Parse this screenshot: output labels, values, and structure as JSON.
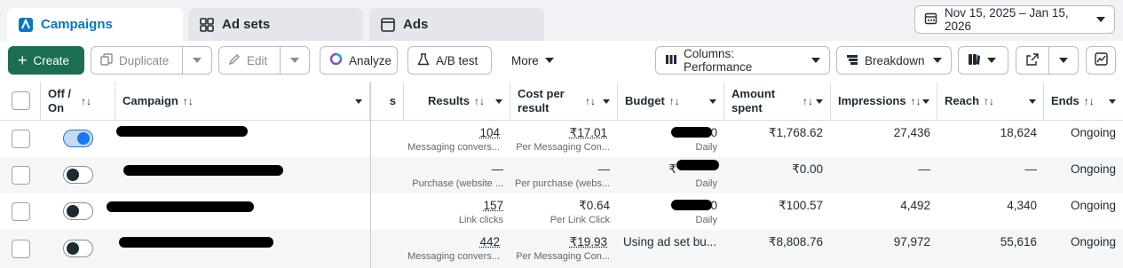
{
  "tabs": [
    {
      "label": "Campaigns",
      "icon": "campaign-icon"
    },
    {
      "label": "Ad sets",
      "icon": "adsets-grid-icon"
    },
    {
      "label": "Ads",
      "icon": "ad-window-icon"
    }
  ],
  "date_range": "Nov 15, 2025 – Jan 15, 2026",
  "toolbar": {
    "create": "Create",
    "duplicate": "Duplicate",
    "edit": "Edit",
    "analyze": "Analyze",
    "ab_test": "A/B test",
    "more": "More",
    "columns": "Columns: Performance",
    "breakdown": "Breakdown"
  },
  "headers": {
    "off_on": "Off / On",
    "campaign": "Campaign",
    "partial": "s",
    "results": "Results",
    "cost_per_result": "Cost per result",
    "budget": "Budget",
    "amount_spent": "Amount spent",
    "impressions": "Impressions",
    "reach": "Reach",
    "ends": "Ends"
  },
  "rows": [
    {
      "on": true,
      "results": "104",
      "results_sub": "Messaging convers...",
      "cost": "₹17.01",
      "cost_sub": "Per Messaging Con...",
      "budget": "0",
      "budget_sub": "Daily",
      "spent": "₹1,768.62",
      "impressions": "27,436",
      "reach": "18,624",
      "ends": "Ongoing"
    },
    {
      "on": false,
      "results": "—",
      "results_sub": "Purchase (website ...",
      "cost": "—",
      "cost_sub": "Per purchase (webs...",
      "budget": "₹",
      "budget_sub": "Daily",
      "spent": "₹0.00",
      "impressions": "—",
      "reach": "—",
      "ends": "Ongoing"
    },
    {
      "on": false,
      "results": "157",
      "results_sub": "Link clicks",
      "cost": "₹0.64",
      "cost_sub": "Per Link Click",
      "budget": "0",
      "budget_sub": "Daily",
      "spent": "₹100.57",
      "impressions": "4,492",
      "reach": "4,340",
      "ends": "Ongoing"
    },
    {
      "on": false,
      "results": "442",
      "results_sub": "Messaging convers...",
      "cost": "₹19.93",
      "cost_sub": "Per Messaging Con...",
      "budget": "Using ad set bu...",
      "budget_sub": "",
      "spent": "₹8,808.76",
      "impressions": "97,972",
      "reach": "55,616",
      "ends": "Ongoing"
    }
  ],
  "colors": {
    "accent": "#0a78be",
    "create_green": "#1b6e4f",
    "toggle_on": "#1877f2"
  }
}
